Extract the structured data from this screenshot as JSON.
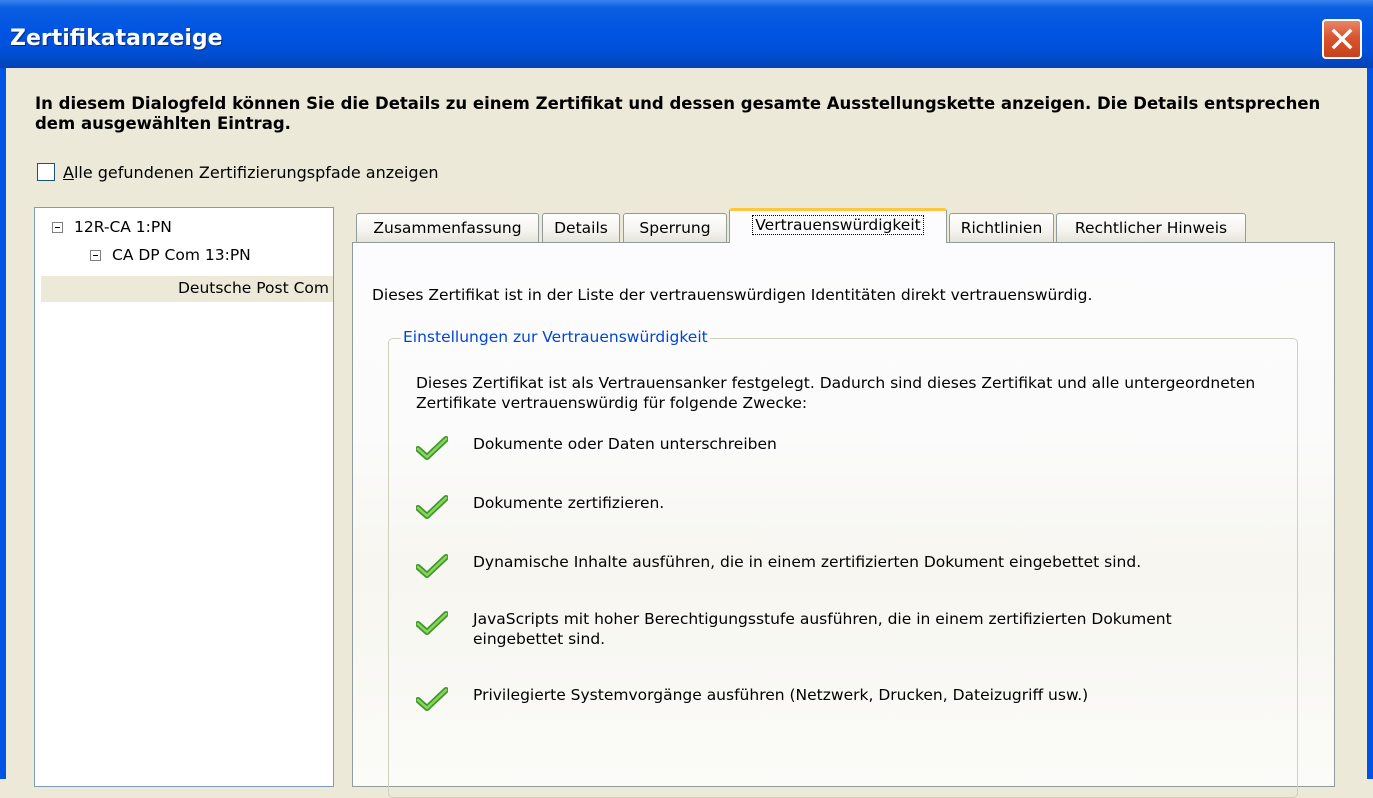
{
  "window": {
    "title": "Zertifikatanzeige"
  },
  "heading": "In diesem Dialogfeld können Sie die Details zu einem Zertifikat und dessen gesamte Ausstellungskette anzeigen. Die Details entsprechen dem ausgewählten Eintrag.",
  "checkbox": {
    "label_accel": "A",
    "label_rest": "lle gefundenen Zertifizierungspfade anzeigen",
    "checked": false
  },
  "tree": {
    "nodes": [
      {
        "label": "12R-CA 1:PN",
        "expanded": true
      },
      {
        "label": "CA DP Com 13:PN",
        "expanded": true
      },
      {
        "label": "Deutsche Post Com",
        "selected": true
      }
    ]
  },
  "tabs": [
    {
      "label": "Zusammenfassung"
    },
    {
      "label": "Details"
    },
    {
      "label": "Sperrung"
    },
    {
      "label": "Vertrauenswürdigkeit",
      "active": true
    },
    {
      "label": "Richtlinien"
    },
    {
      "label": "Rechtlicher Hinweis"
    }
  ],
  "trust": {
    "summary": "Dieses Zertifikat ist in der Liste der vertrauenswürdigen Identitäten direkt vertrauenswürdig.",
    "group_label": "Einstellungen zur Vertrauenswürdigkeit",
    "intro": "Dieses Zertifikat ist als Vertrauensanker festgelegt. Dadurch sind dieses Zertifikat und alle untergeordneten Zertifikate vertrauenswürdig für folgende Zwecke:",
    "items": [
      {
        "icon": "checkmark-icon",
        "text": "Dokumente oder Daten unterschreiben"
      },
      {
        "icon": "checkmark-icon",
        "text": "Dokumente zertifizieren."
      },
      {
        "icon": "checkmark-icon",
        "text": "Dynamische Inhalte ausführen, die in einem zertifizierten Dokument eingebettet sind."
      },
      {
        "icon": "checkmark-icon",
        "text": "JavaScripts mit hoher Berechtigungsstufe ausführen, die in einem zertifizierten Dokument eingebettet sind."
      },
      {
        "icon": "checkmark-icon",
        "text": "Privilegierte Systemvorgänge ausführen (Netzwerk, Drucken, Dateizugriff usw.)"
      }
    ]
  },
  "colors": {
    "titlebar": "#0054e3",
    "close": "#d9552f",
    "legend": "#0046d5",
    "check": "#5cb83a",
    "active_tab": "#ffc83c"
  }
}
